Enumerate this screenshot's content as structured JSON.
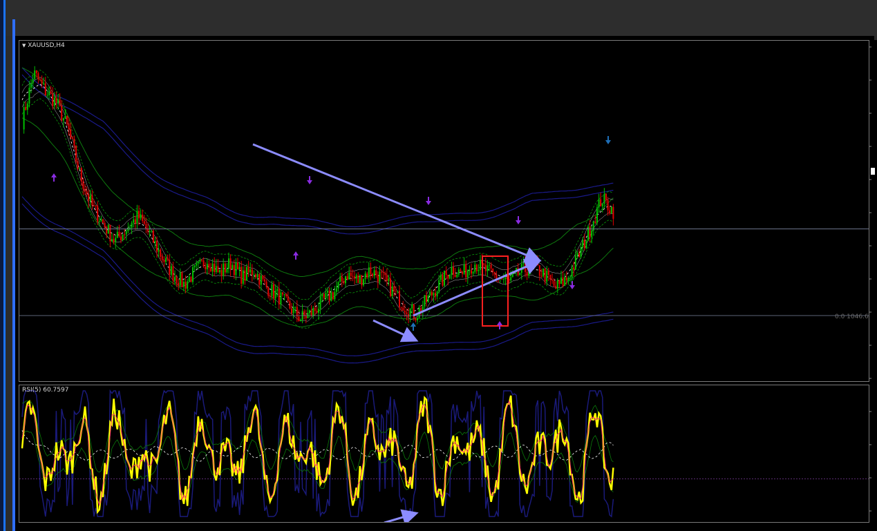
{
  "window": {
    "symbol_label": "XAUUSD,H4",
    "rsi_label": "RSI(5) 60.7597",
    "hline_label": "0.0 1046.62"
  },
  "colors": {
    "background": "#000000",
    "bull_candle": "#00c000",
    "bear_candle": "#e00000",
    "rsi_line": "#ffff00",
    "rsi_signal": "#ff3070",
    "annotation": "#8c8cff",
    "highlight_box": "#ff2020",
    "band_blue": "#1a1a8a",
    "band_green": "#0e7a0e",
    "level_line": "#7d84a0"
  },
  "chart_data": [
    {
      "type": "candlestick",
      "title": "XAUUSD,H4",
      "price_path": [
        1155,
        1182,
        1172,
        1165,
        1150,
        1125,
        1108,
        1098,
        1088,
        1095,
        1102,
        1092,
        1080,
        1070,
        1064,
        1072,
        1078,
        1070,
        1076,
        1068,
        1072,
        1063,
        1058,
        1052,
        1045,
        1048,
        1055,
        1060,
        1070,
        1066,
        1072,
        1068,
        1060,
        1052,
        1047,
        1056,
        1064,
        1073,
        1070,
        1076,
        1072,
        1068,
        1065,
        1071,
        1074,
        1070,
        1062,
        1067,
        1080,
        1095,
        1112,
        1105
      ],
      "horizontal_levels": [
        1095,
        1046.62
      ],
      "arrows_up": [
        "swing low",
        "swing low",
        "swing low"
      ],
      "arrows_down": [
        "swing high",
        "swing high",
        "swing high",
        "swing high"
      ]
    },
    {
      "type": "line",
      "title": "RSI(5) 60.7597",
      "indicator": "RSI(5)",
      "last_value": 60.7597,
      "levels": [
        30
      ]
    }
  ]
}
